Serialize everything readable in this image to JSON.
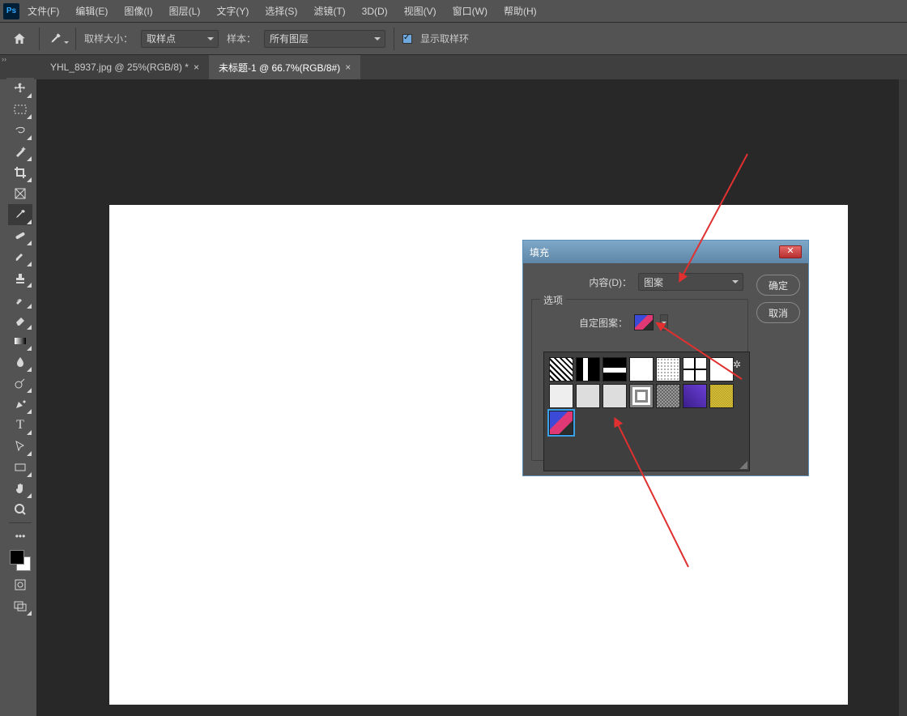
{
  "app": {
    "logo_text": "Ps"
  },
  "menu": {
    "file": "文件(F)",
    "edit": "编辑(E)",
    "image": "图像(I)",
    "layer": "图层(L)",
    "type": "文字(Y)",
    "select": "选择(S)",
    "filter": "滤镜(T)",
    "threeD": "3D(D)",
    "view": "视图(V)",
    "window": "窗口(W)",
    "help": "帮助(H)"
  },
  "options_bar": {
    "sample_size_label": "取样大小：",
    "sample_size_value": "取样点",
    "sample_label": "样本：",
    "sample_value": "所有图层",
    "show_sample_ring": "显示取样环"
  },
  "tabs": {
    "t0": {
      "label": "YHL_8937.jpg @ 25%(RGB/8) *",
      "close": "×"
    },
    "t1": {
      "label": "未标题-1 @ 66.7%(RGB/8#)",
      "close": "×"
    }
  },
  "dialog": {
    "title": "填充",
    "content_label": "内容(D)：",
    "content_value": "图案",
    "ok": "确定",
    "cancel": "取消",
    "options_legend": "选项",
    "custom_pattern_label": "自定图案："
  },
  "pattern_popup": {
    "gear": "✲"
  }
}
